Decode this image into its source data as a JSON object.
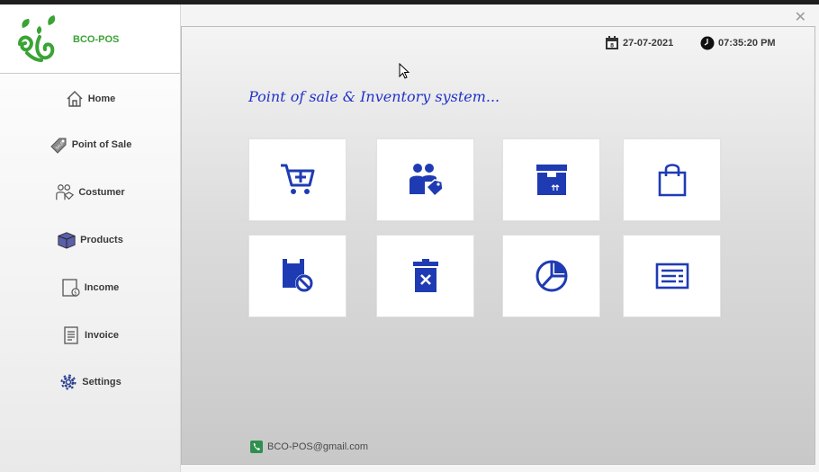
{
  "app": {
    "brand_name": "BCO-POS",
    "close_glyph": "✕"
  },
  "sidebar": {
    "items": [
      {
        "label": "Home",
        "icon": "home-icon"
      },
      {
        "label": "Point of Sale",
        "icon": "price-tag-icon"
      },
      {
        "label": "Costumer",
        "icon": "customers-icon"
      },
      {
        "label": "Products",
        "icon": "box-icon"
      },
      {
        "label": "Income",
        "icon": "income-icon"
      },
      {
        "label": "Invoice",
        "icon": "invoice-icon"
      },
      {
        "label": "Settings",
        "icon": "gear-icon"
      }
    ]
  },
  "header": {
    "date": "27-07-2021",
    "time": "07:35:20 PM"
  },
  "main": {
    "subtitle": "Point of sale & Inventory system..."
  },
  "tiles": [
    {
      "icon": "add-to-cart-icon"
    },
    {
      "icon": "customer-tag-icon"
    },
    {
      "icon": "product-box-icon"
    },
    {
      "icon": "shopping-bag-icon"
    },
    {
      "icon": "blocked-item-icon"
    },
    {
      "icon": "delete-icon"
    },
    {
      "icon": "pie-chart-icon"
    },
    {
      "icon": "list-report-icon"
    }
  ],
  "footer": {
    "email": "BCO-POS@gmail.com"
  },
  "colors": {
    "accent_blue": "#2232c8",
    "icon_blue": "#1f3bb3",
    "brand_green": "#3aa335"
  }
}
